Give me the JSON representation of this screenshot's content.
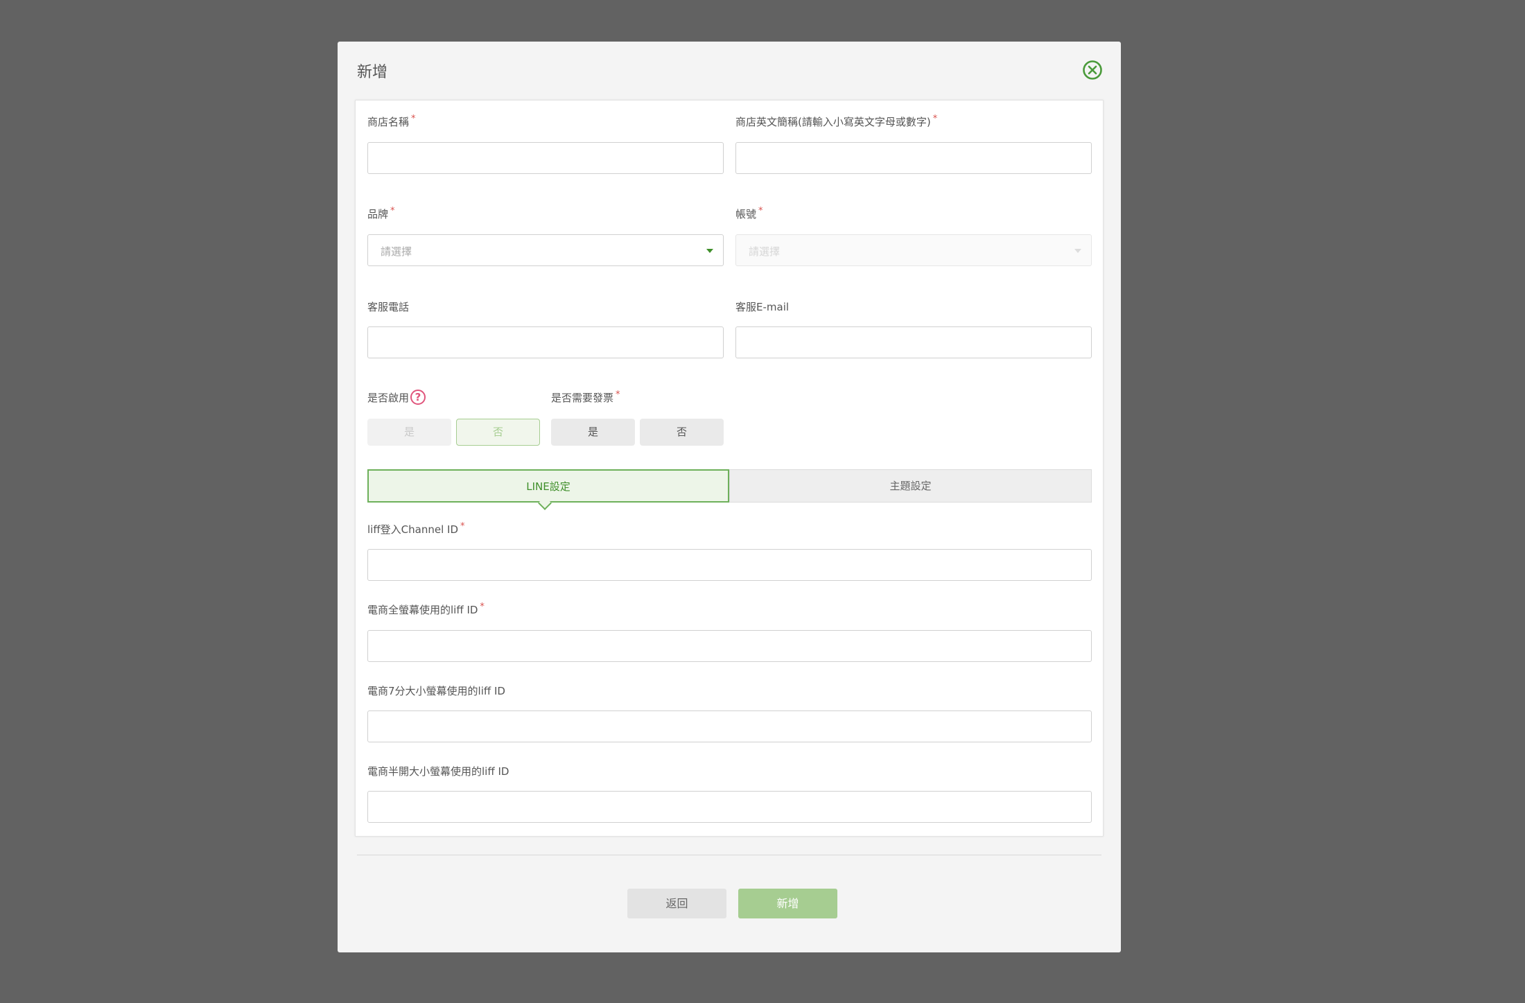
{
  "modal": {
    "title": "新增"
  },
  "form": {
    "store_name": {
      "label": "商店名稱",
      "value": ""
    },
    "store_en_name": {
      "label": "商店英文簡稱(請輸入小寫英文字母或數字)",
      "value": ""
    },
    "brand": {
      "label": "品牌",
      "placeholder": "請選擇"
    },
    "account": {
      "label": "帳號",
      "placeholder": "請選擇"
    },
    "service_phone": {
      "label": "客服電話",
      "value": ""
    },
    "service_email": {
      "label": "客服E-mail",
      "value": ""
    },
    "enabled": {
      "label": "是否啟用",
      "yes": "是",
      "no": "否",
      "selected": "否"
    },
    "invoice": {
      "label": "是否需要發票",
      "yes": "是",
      "no": "否"
    },
    "required_mark": "*"
  },
  "tabs": [
    {
      "label": "LINE設定",
      "active": true
    },
    {
      "label": "主題設定",
      "active": false
    }
  ],
  "line_settings": {
    "channel_id": {
      "label": "liff登入Channel ID",
      "value": ""
    },
    "full_liff": {
      "label": "電商全螢幕使用的liff ID",
      "value": ""
    },
    "tall_liff": {
      "label": "電商7分大小螢幕使用的liff ID",
      "value": ""
    },
    "compact_liff": {
      "label": "電商半開大小螢幕使用的liff ID",
      "value": ""
    }
  },
  "footer": {
    "back_label": "返回",
    "submit_label": "新增"
  },
  "colors": {
    "accent_green": "#3f8f2a",
    "light_green": "#a6cd91",
    "required_red": "#d9534f",
    "help_pink": "#e0557c"
  },
  "icons": {
    "close": "close-circle-icon",
    "help": "question-circle-icon",
    "dropdown": "caret-down-icon"
  }
}
